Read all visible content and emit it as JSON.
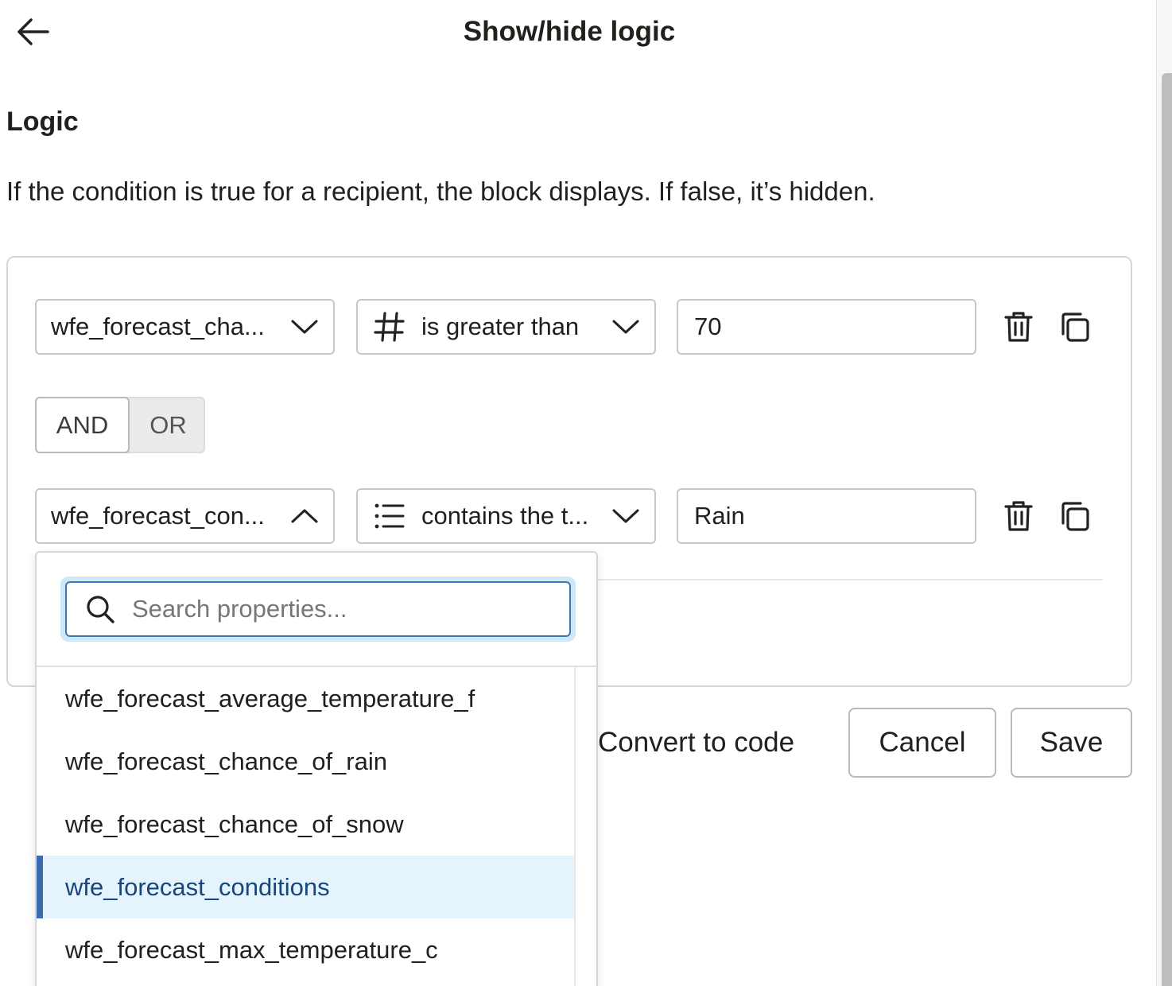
{
  "header": {
    "title": "Show/hide logic"
  },
  "logic": {
    "section_title": "Logic",
    "description": "If the condition is true for a recipient, the block displays. If false, it’s hidden."
  },
  "conditions": [
    {
      "property": "wfe_forecast_cha...",
      "operator": "is greater than",
      "operator_icon": "hash-icon",
      "value": "70",
      "property_open": false
    },
    {
      "property": "wfe_forecast_con...",
      "operator": "contains the t...",
      "operator_icon": "list-icon",
      "value": "Rain",
      "property_open": true
    }
  ],
  "connector": {
    "and_label": "AND",
    "or_label": "OR",
    "selected": "AND"
  },
  "footer": {
    "convert_label": "Convert to code",
    "cancel_label": "Cancel",
    "save_label": "Save"
  },
  "dropdown": {
    "search_placeholder": "Search properties...",
    "items": [
      "wfe_forecast_average_temperature_f",
      "wfe_forecast_chance_of_rain",
      "wfe_forecast_chance_of_snow",
      "wfe_forecast_conditions",
      "wfe_forecast_max_temperature_c"
    ],
    "selected": "wfe_forecast_conditions"
  },
  "colors": {
    "accent": "#3d78b8",
    "selected_bg": "#e5f4fc",
    "selected_bar": "#3a6bb0",
    "border": "#c8c8c8"
  }
}
